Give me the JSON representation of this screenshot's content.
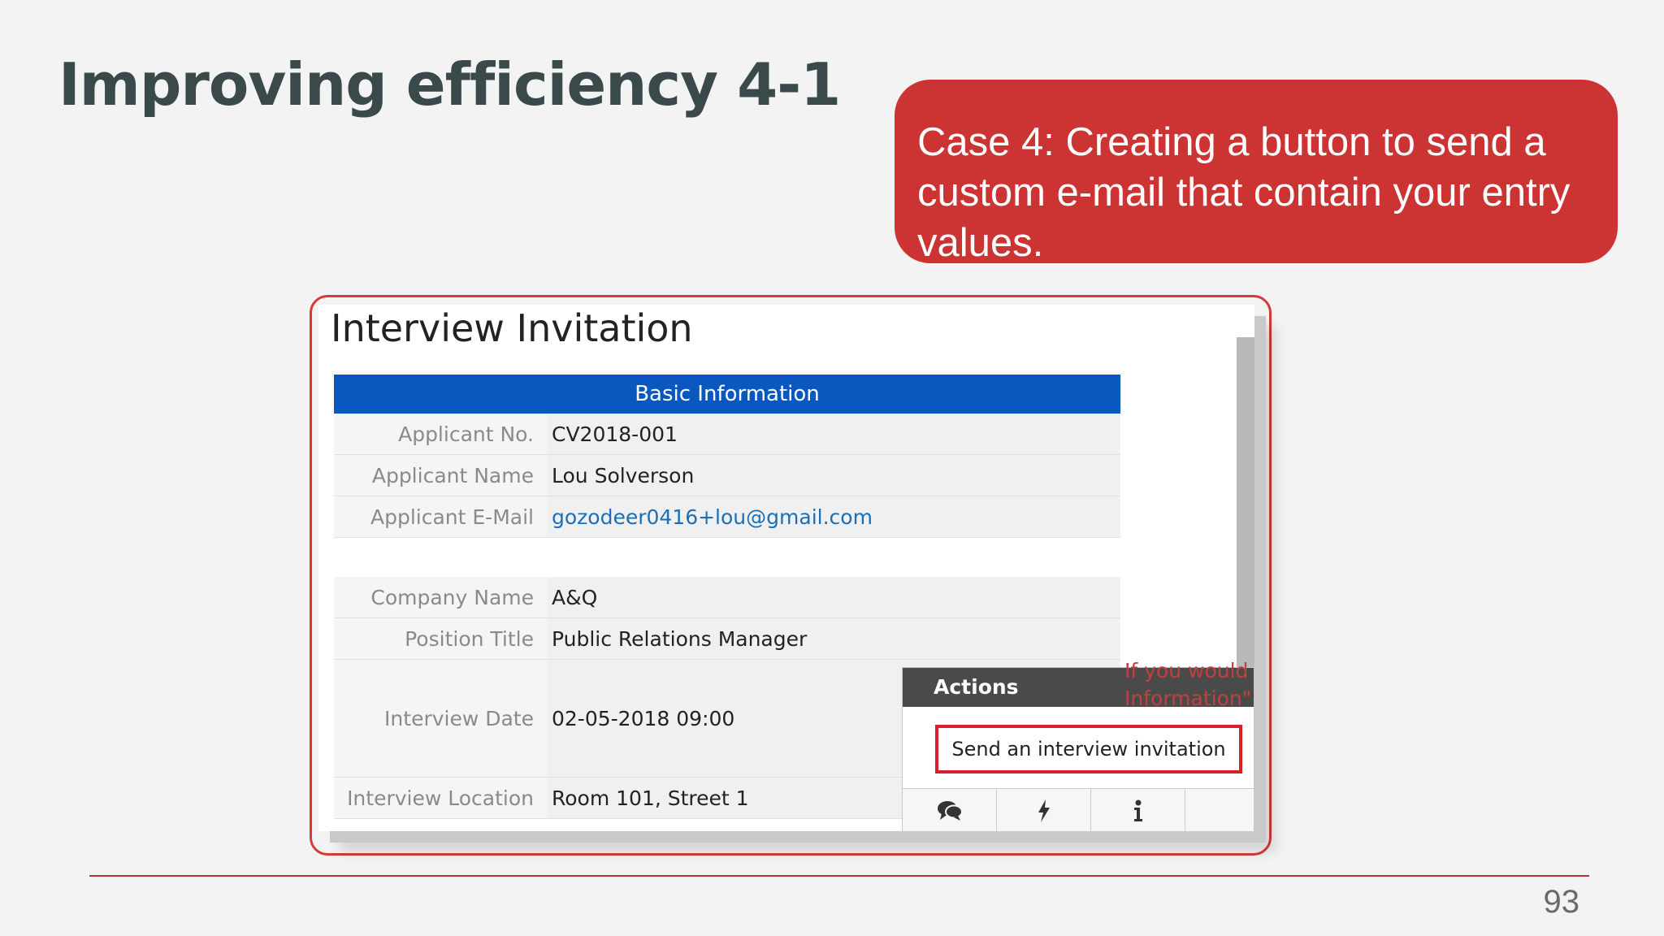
{
  "slide": {
    "title": "Improving efficiency 4-1",
    "callout": "Case 4: Creating a button to send a custom e-mail that contain your entry values.",
    "page_number": "93",
    "accent_color": "#cc3333"
  },
  "form": {
    "title": "Interview Invitation",
    "section_header": "Basic Information",
    "header_color": "#0b57c0",
    "rows": [
      {
        "label": "Applicant No.",
        "value": "CV2018-001"
      },
      {
        "label": "Applicant Name",
        "value": "Lou Solverson"
      },
      {
        "label": "Applicant E-Mail",
        "value": "gozodeer0416+lou@gmail.com"
      },
      {
        "label": "Company Name",
        "value": "A&Q"
      },
      {
        "label": "Position Title",
        "value": "Public Relations Manager"
      },
      {
        "label": "Interview Date",
        "value": "02-05-2018 09:00"
      },
      {
        "label": "Interview Location",
        "value": "Room 101, Street 1"
      }
    ],
    "clipped_text": [
      "If you would",
      "Information\""
    ]
  },
  "actions": {
    "header": "Actions",
    "button_label": "Send an interview invitation",
    "icons": [
      "chat-icon",
      "lightning-icon",
      "info-icon"
    ]
  }
}
